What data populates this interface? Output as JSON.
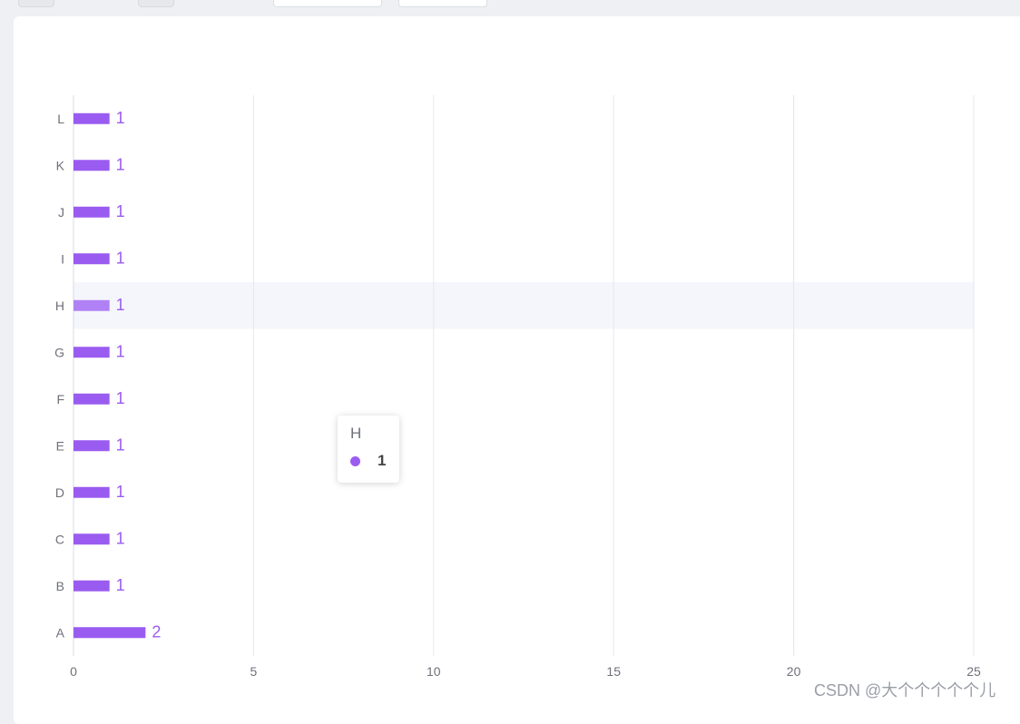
{
  "chart_data": {
    "type": "bar",
    "orientation": "horizontal",
    "categories": [
      "A",
      "B",
      "C",
      "D",
      "E",
      "F",
      "G",
      "H",
      "I",
      "J",
      "K",
      "L"
    ],
    "values": [
      2,
      1,
      1,
      1,
      1,
      1,
      1,
      1,
      1,
      1,
      1,
      1
    ],
    "xlim": [
      0,
      25
    ],
    "xticks": [
      0,
      5,
      10,
      15,
      20,
      25
    ],
    "grid": "vertical",
    "bar_color": "#9a5cf0",
    "label_color": "#9a5cf0",
    "highlighted_category": "H"
  },
  "tooltip": {
    "title": "H",
    "value": "1",
    "marker_color": "#9a5cf0"
  },
  "watermark": "CSDN @大个个个个个儿"
}
